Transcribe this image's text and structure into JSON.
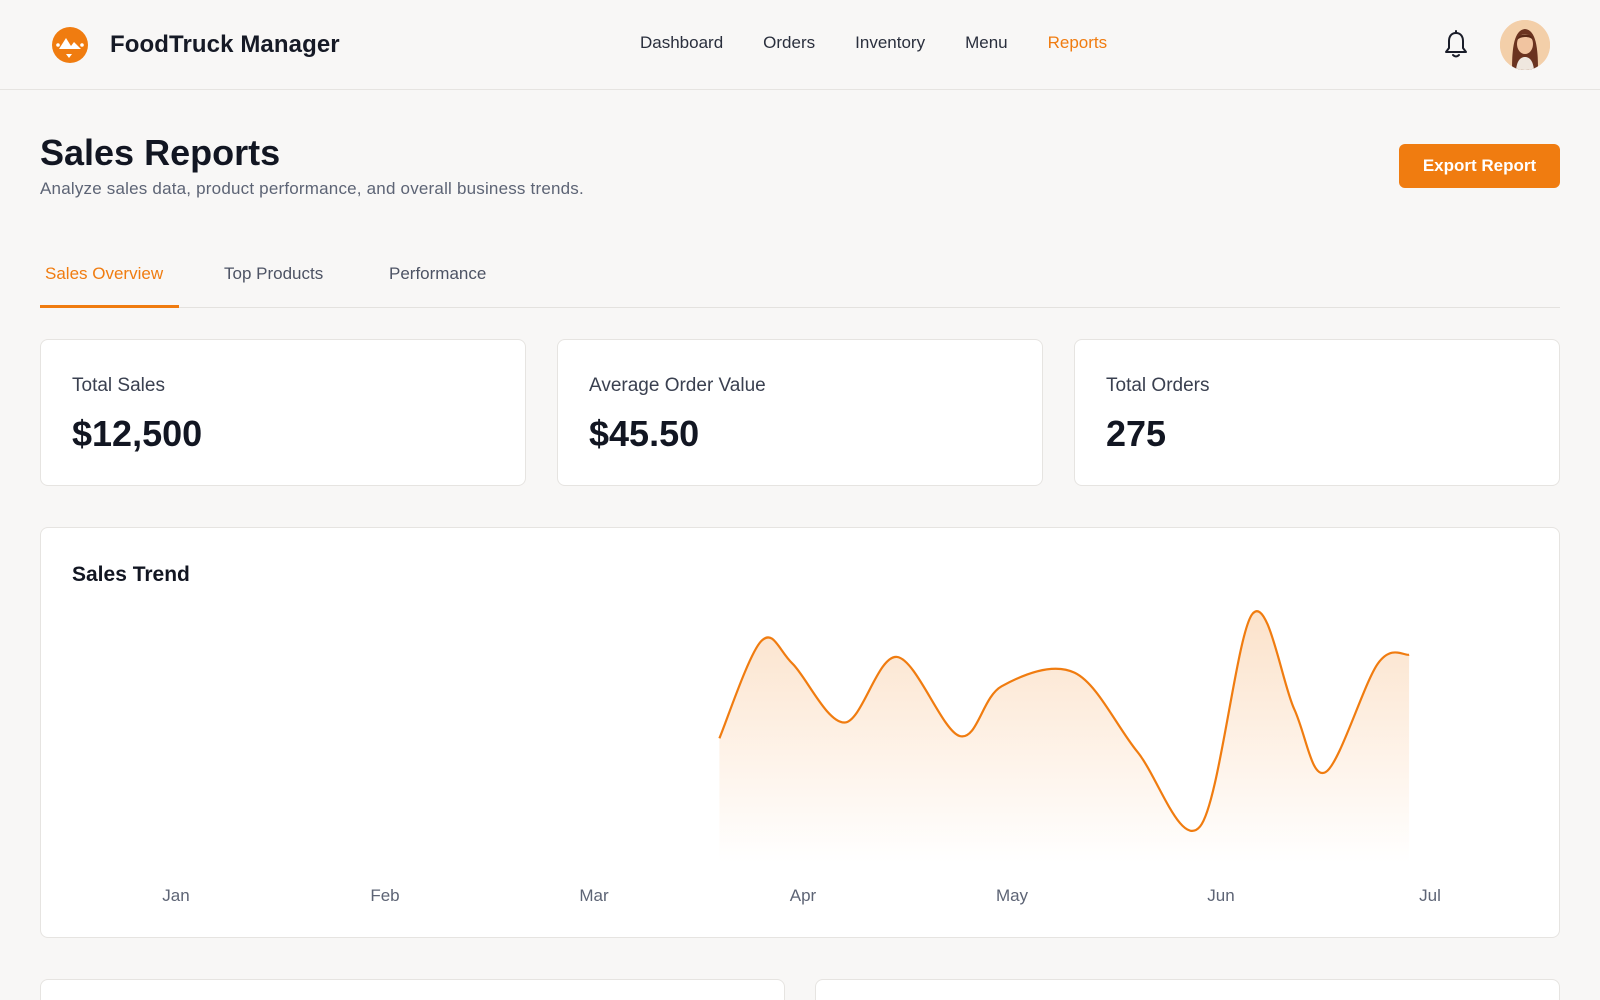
{
  "app": {
    "name": "FoodTruck Manager",
    "logo_icon": "food-truck-logo-icon",
    "accent_color": "#f07c10"
  },
  "nav": {
    "items": [
      {
        "label": "Dashboard",
        "active": false
      },
      {
        "label": "Orders",
        "active": false
      },
      {
        "label": "Inventory",
        "active": false
      },
      {
        "label": "Menu",
        "active": false
      },
      {
        "label": "Reports",
        "active": true
      }
    ],
    "notification_icon": "bell-icon",
    "avatar": "user-avatar"
  },
  "page": {
    "title": "Sales Reports",
    "subtitle": "Analyze sales data, product performance, and overall business trends.",
    "export_label": "Export Report"
  },
  "tabs": [
    {
      "label": "Sales Overview",
      "active": true
    },
    {
      "label": "Top Products",
      "active": false
    },
    {
      "label": "Performance",
      "active": false
    }
  ],
  "stats": [
    {
      "label": "Total Sales",
      "value": "$12,500"
    },
    {
      "label": "Average Order Value",
      "value": "$45.50"
    },
    {
      "label": "Total Orders",
      "value": "275"
    }
  ],
  "sales_trend": {
    "title": "Sales Trend"
  },
  "chart_data": {
    "type": "area",
    "title": "Sales Trend",
    "categories": [
      "Jan",
      "Feb",
      "Mar",
      "Apr",
      "May",
      "Jun",
      "Jul"
    ],
    "x": [
      2.6,
      2.8,
      2.95,
      3.2,
      3.45,
      3.75,
      3.95,
      4.3,
      4.6,
      4.9,
      5.15,
      5.35,
      5.5,
      5.75,
      5.9
    ],
    "y": [
      0.45,
      0.88,
      0.78,
      0.52,
      0.81,
      0.46,
      0.68,
      0.74,
      0.39,
      0.06,
      1.0,
      0.58,
      0.3,
      0.78,
      0.82
    ],
    "y_units": "relative (no y-axis shown)",
    "grid": false,
    "legend": "none",
    "color": "#f07c10"
  }
}
